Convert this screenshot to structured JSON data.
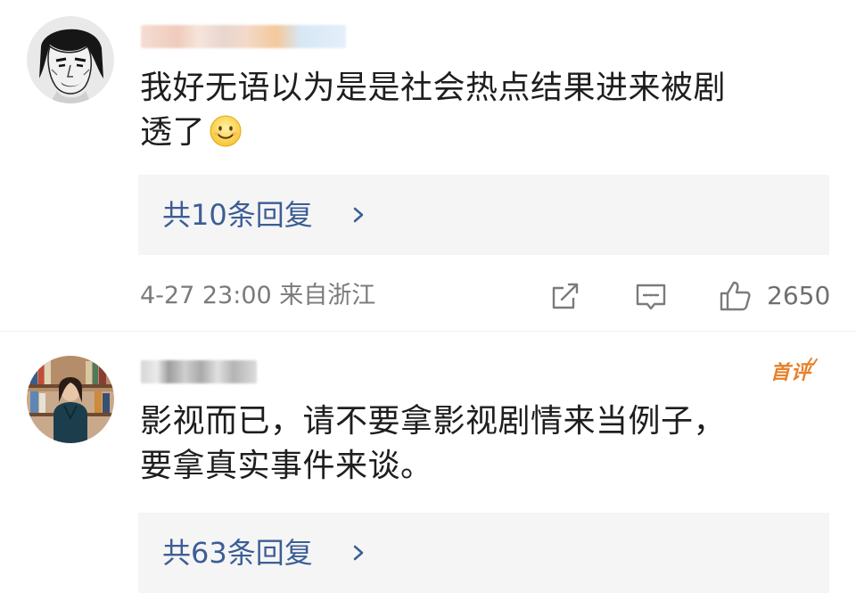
{
  "comments": [
    {
      "text_line1": "我好无语以为是是社会热点结果进来被剧",
      "text_line2": "透了",
      "emoji_icon": "smile-emoji-icon",
      "replies_label": "共10条回复",
      "meta": "4-27 23:00 来自浙江",
      "like_count": "2650"
    },
    {
      "badge": "首评",
      "text_line1": "影视而已，请不要拿影视剧情来当例子，",
      "text_line2": "要拿真实事件来谈。",
      "replies_label": "共63条回复"
    }
  ],
  "colors": {
    "link": "#3d5d95",
    "meta": "#7b7b7b",
    "reply_box_bg": "#f5f5f5",
    "badge": "#e8802b"
  },
  "icons": [
    "forward-icon",
    "comment-icon",
    "like-icon",
    "chevron-right-icon"
  ]
}
